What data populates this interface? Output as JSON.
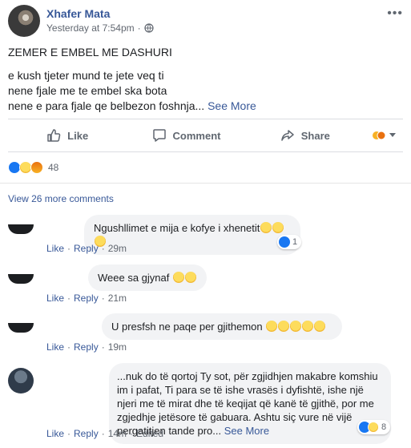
{
  "post": {
    "author": "Xhafer Mata",
    "timestamp": "Yesterday at 7:54pm",
    "audience_icon": "globe-icon",
    "title": "ZEMER E EMBEL ME DASHURI",
    "lines": [
      "e kush tjeter mund te jete veq ti",
      "nene fjale me te embel ska bota",
      "nene e para fjale qe belbezon foshnja..."
    ],
    "see_more": "See More"
  },
  "actions": {
    "like": "Like",
    "comment": "Comment",
    "share": "Share"
  },
  "reactions": {
    "count": "48",
    "colors": {
      "like": "#1877f2",
      "sad": "#f7b125",
      "angry": "#e9710f"
    }
  },
  "comments_section": {
    "view_more": "View 26 more comments",
    "comments": [
      {
        "text": "Ngushllimet e mija e kofye i xhenetit",
        "reaction_count": "1",
        "like": "Like",
        "reply": "Reply",
        "time": "29m"
      },
      {
        "text": "Weee sa gjynaf",
        "like": "Like",
        "reply": "Reply",
        "time": "21m"
      },
      {
        "text": "U presfsh ne paqe per gjithemon",
        "like": "Like",
        "reply": "Reply",
        "time": "19m"
      },
      {
        "text": "...nuk do të qortoj Ty sot, për zgjidhjen makabre komshiu im i pafat, Ti para se të ishe vrasës i dyfishtë, ishe një njeri me të mirat dhe të keqijat që kanë të gjithë, por me zgjedhje jetësore të gabuara. Ashtu siç vure në vijë pergatitjen tande pro...",
        "see_more": "See More",
        "reaction_count": "8",
        "like": "Like",
        "reply": "Reply",
        "time": "14m",
        "edited": "Edited"
      }
    ]
  },
  "theme": {
    "link": "#385898",
    "meta": "#616770",
    "bubble": "#f2f3f5"
  }
}
